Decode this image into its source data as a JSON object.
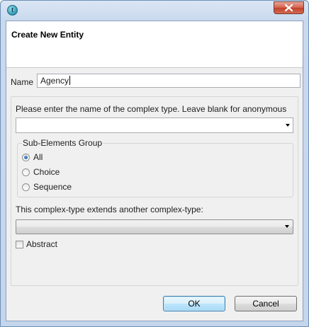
{
  "window": {
    "app_icon_glyph": "t",
    "close_icon": "close-icon"
  },
  "header": {
    "title": "Create New Entity"
  },
  "form": {
    "name_label": "Name",
    "name_value": "Agency",
    "complex_type_prompt": "Please enter the name of the complex type. Leave blank for anonymous",
    "complex_type_value": "",
    "sub_elements_group": {
      "title": "Sub-Elements Group",
      "options": [
        "All",
        "Choice",
        "Sequence"
      ],
      "selected": "All"
    },
    "extends_label": "This complex-type extends another complex-type:",
    "extends_value": "",
    "abstract_label": "Abstract",
    "abstract_checked": false
  },
  "buttons": {
    "ok": "OK",
    "cancel": "Cancel"
  }
}
